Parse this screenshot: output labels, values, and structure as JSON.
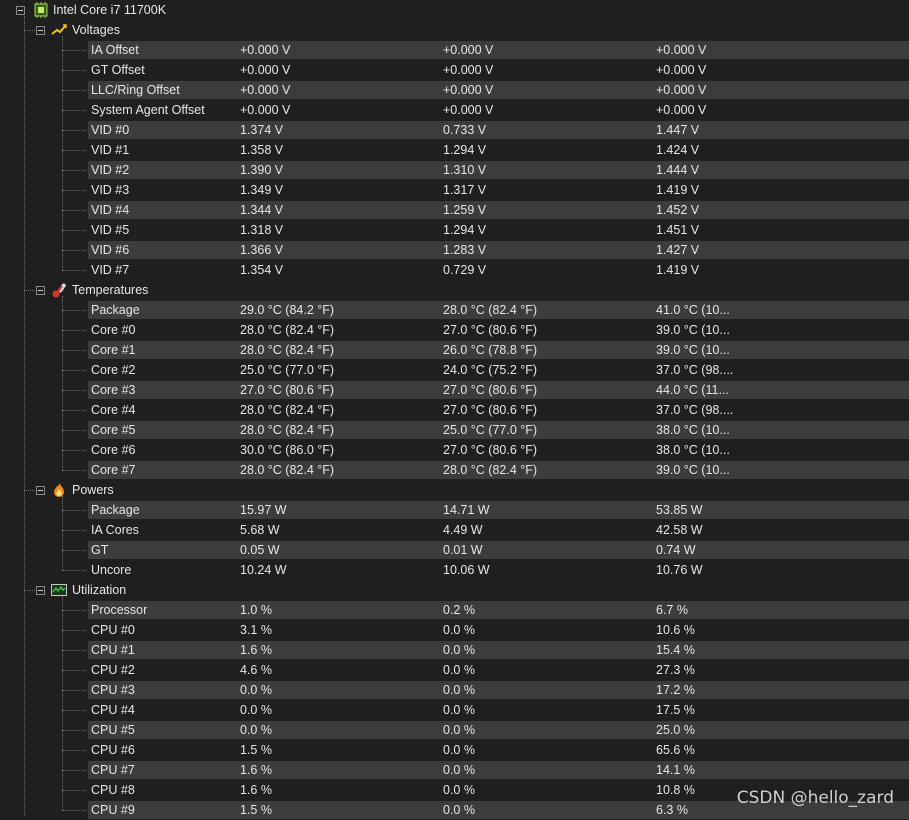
{
  "root": {
    "label": "Intel Core i7 11700K",
    "icon": "cpu-chip-icon"
  },
  "sections": [
    {
      "label": "Voltages",
      "icon": "voltage-icon",
      "rows": [
        [
          "IA Offset",
          "+0.000 V",
          "+0.000 V",
          "+0.000 V"
        ],
        [
          "GT Offset",
          "+0.000 V",
          "+0.000 V",
          "+0.000 V"
        ],
        [
          "LLC/Ring Offset",
          "+0.000 V",
          "+0.000 V",
          "+0.000 V"
        ],
        [
          "System Agent Offset",
          "+0.000 V",
          "+0.000 V",
          "+0.000 V"
        ],
        [
          "VID #0",
          "1.374 V",
          "0.733 V",
          "1.447 V"
        ],
        [
          "VID #1",
          "1.358 V",
          "1.294 V",
          "1.424 V"
        ],
        [
          "VID #2",
          "1.390 V",
          "1.310 V",
          "1.444 V"
        ],
        [
          "VID #3",
          "1.349 V",
          "1.317 V",
          "1.419 V"
        ],
        [
          "VID #4",
          "1.344 V",
          "1.259 V",
          "1.452 V"
        ],
        [
          "VID #5",
          "1.318 V",
          "1.294 V",
          "1.451 V"
        ],
        [
          "VID #6",
          "1.366 V",
          "1.283 V",
          "1.427 V"
        ],
        [
          "VID #7",
          "1.354 V",
          "0.729 V",
          "1.419 V"
        ]
      ]
    },
    {
      "label": "Temperatures",
      "icon": "thermometer-icon",
      "rows": [
        [
          "Package",
          "29.0 °C  (84.2 °F)",
          "28.0 °C  (82.4 °F)",
          "41.0 °C  (10..."
        ],
        [
          "Core #0",
          "28.0 °C  (82.4 °F)",
          "27.0 °C  (80.6 °F)",
          "39.0 °C  (10..."
        ],
        [
          "Core #1",
          "28.0 °C  (82.4 °F)",
          "26.0 °C  (78.8 °F)",
          "39.0 °C  (10..."
        ],
        [
          "Core #2",
          "25.0 °C  (77.0 °F)",
          "24.0 °C  (75.2 °F)",
          "37.0 °C  (98...."
        ],
        [
          "Core #3",
          "27.0 °C  (80.6 °F)",
          "27.0 °C  (80.6 °F)",
          "44.0 °C  (11..."
        ],
        [
          "Core #4",
          "28.0 °C  (82.4 °F)",
          "27.0 °C  (80.6 °F)",
          "37.0 °C  (98...."
        ],
        [
          "Core #5",
          "28.0 °C  (82.4 °F)",
          "25.0 °C  (77.0 °F)",
          "38.0 °C  (10..."
        ],
        [
          "Core #6",
          "30.0 °C  (86.0 °F)",
          "27.0 °C  (80.6 °F)",
          "38.0 °C  (10..."
        ],
        [
          "Core #7",
          "28.0 °C  (82.4 °F)",
          "28.0 °C  (82.4 °F)",
          "39.0 °C  (10..."
        ]
      ]
    },
    {
      "label": "Powers",
      "icon": "flame-icon",
      "rows": [
        [
          "Package",
          "15.97 W",
          "14.71 W",
          "53.85 W"
        ],
        [
          "IA Cores",
          "5.68 W",
          "4.49 W",
          "42.58 W"
        ],
        [
          "GT",
          "0.05 W",
          "0.01 W",
          "0.74 W"
        ],
        [
          "Uncore",
          "10.24 W",
          "10.06 W",
          "10.76 W"
        ]
      ]
    },
    {
      "label": "Utilization",
      "icon": "utilization-graph-icon",
      "rows": [
        [
          "Processor",
          "1.0 %",
          "0.2 %",
          "6.7 %"
        ],
        [
          "CPU #0",
          "3.1 %",
          "0.0 %",
          "10.6 %"
        ],
        [
          "CPU #1",
          "1.6 %",
          "0.0 %",
          "15.4 %"
        ],
        [
          "CPU #2",
          "4.6 %",
          "0.0 %",
          "27.3 %"
        ],
        [
          "CPU #3",
          "0.0 %",
          "0.0 %",
          "17.2 %"
        ],
        [
          "CPU #4",
          "0.0 %",
          "0.0 %",
          "17.5 %"
        ],
        [
          "CPU #5",
          "0.0 %",
          "0.0 %",
          "25.0 %"
        ],
        [
          "CPU #6",
          "1.5 %",
          "0.0 %",
          "65.6 %"
        ],
        [
          "CPU #7",
          "1.6 %",
          "0.0 %",
          "14.1 %"
        ],
        [
          "CPU #8",
          "1.6 %",
          "0.0 %",
          "10.8 %"
        ],
        [
          "CPU #9",
          "1.5 %",
          "0.0 %",
          "6.3 %"
        ]
      ]
    }
  ],
  "watermark": "CSDN @hello_zard",
  "colors": {
    "background": "#1f1f1f",
    "row_alt": "#3c3c3c",
    "text": "#e6e6e6"
  }
}
